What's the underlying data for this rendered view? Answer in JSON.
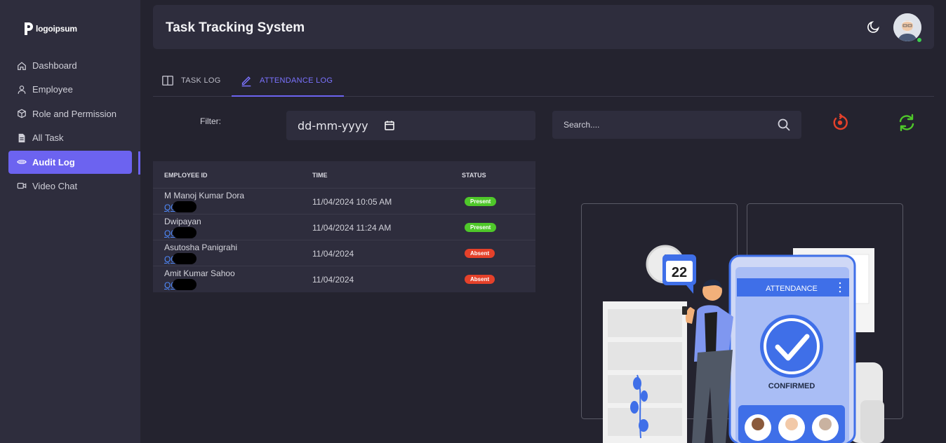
{
  "app": {
    "title": "Task Tracking System",
    "logo_text": "logoipsum"
  },
  "sidebar": {
    "items": [
      {
        "label": "Dashboard",
        "icon": "home-icon",
        "active": false
      },
      {
        "label": "Employee",
        "icon": "user-icon",
        "active": false
      },
      {
        "label": "Role and Permission",
        "icon": "cube-icon",
        "active": false
      },
      {
        "label": "All Task",
        "icon": "document-icon",
        "active": false
      },
      {
        "label": "Audit Log",
        "icon": "eye-icon",
        "active": true
      },
      {
        "label": "Video Chat",
        "icon": "video-icon",
        "active": false
      }
    ]
  },
  "header": {
    "theme_icon": "moon-icon",
    "avatar": "user-avatar"
  },
  "tabs": [
    {
      "label": "TASK LOG",
      "icon": "book-icon",
      "active": false
    },
    {
      "label": "ATTENDANCE LOG",
      "icon": "pencil-icon",
      "active": true
    }
  ],
  "filter": {
    "label": "Filter:",
    "date_placeholder": "dd-mm-yyyy"
  },
  "search": {
    "placeholder": "Search...."
  },
  "table": {
    "columns": [
      "EMPLOYEE ID",
      "TIME",
      "STATUS"
    ],
    "rows": [
      {
        "name": "M Manoj Kumar Dora",
        "id": "Q00",
        "time": "11/04/2024 10:05 AM",
        "status": "Present"
      },
      {
        "name": "Dwipayan",
        "id": "Q00",
        "time": "11/04/2024 11:24 AM",
        "status": "Present"
      },
      {
        "name": "Asutosha Panigrahi",
        "id": "Q0",
        "time": "11/04/2024",
        "status": "Absent"
      },
      {
        "name": "Amit Kumar Sahoo",
        "id": "Q0",
        "time": "11/04/2024",
        "status": "Absent"
      }
    ]
  },
  "illustration": {
    "calendar_day": "22",
    "banner": "ATTENDANCE",
    "caption": "CONFIRMED"
  },
  "colors": {
    "accent": "#6c63f0",
    "present": "#4fc82a",
    "absent": "#e5412a",
    "link": "#4f8bff"
  }
}
